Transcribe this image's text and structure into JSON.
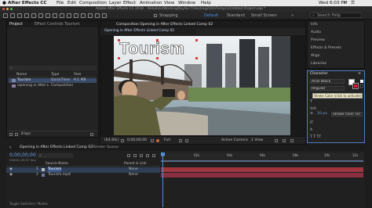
{
  "menubar": {
    "apple": "",
    "app_name": "After Effects CC",
    "items": [
      "File",
      "Edit",
      "Composition",
      "Layer",
      "Effect",
      "Animation",
      "View",
      "Window",
      "Help"
    ],
    "clock": "Wed 6:03 PM"
  },
  "titlebar": {
    "title": "Adobe After Effects CC 2018 - /Volumes/Working/Keyfer/7/Hosting2000/Temp/1/Untitled Project.aep *"
  },
  "toolbar": {
    "snapping": "Snapping",
    "workspaces": [
      "Default",
      "Standard",
      "Small Screen"
    ],
    "active_workspace": "Default",
    "search": "Search Help"
  },
  "project": {
    "tabs": [
      "Project",
      "Effect Controls Tourism"
    ],
    "columns": [
      "Name",
      "Type",
      "Size"
    ],
    "items": [
      {
        "name": "Tourism",
        "type": "QuickTime",
        "size": "9.1 MB"
      },
      {
        "name": "Opening in After Effects",
        "type": "Composition",
        "size": ""
      }
    ],
    "footer": "8 bpc"
  },
  "viewer": {
    "tab": "Composition Opening in After Effects Linked Comp 02",
    "subtab": "Opening in After Effects Linked Comp 02",
    "zoom": "(64.8%)",
    "timecode": "0;00;00;00",
    "resolution": "Full",
    "camera": "Active Camera",
    "views": "1 View",
    "overlay_text": "Tourism"
  },
  "right_panels": {
    "items": [
      "Info",
      "Audio",
      "Preview",
      "Effects & Presets",
      "Align",
      "Libraries"
    ]
  },
  "character": {
    "title": "Character",
    "font": "Arial Black",
    "style": "Regular",
    "tooltip": "Stroke Color (click to activate)",
    "stroke_width": "10 px",
    "stroke_mode": "Stroke Over Fill",
    "fill_color": "#ffffff",
    "stroke_color": "#cc2233"
  },
  "timeline": {
    "tabs": [
      "Opening in After Effects Linked Comp 02",
      "Render Queue"
    ],
    "timecode": "0;00;00;00",
    "fps": "00000 (29.97 fps)",
    "columns": [
      "Source Name",
      "Parent & Link"
    ],
    "layers": [
      {
        "index": "1",
        "name": "Tourism",
        "parent": "None"
      },
      {
        "index": "2",
        "name": "Tourism.mp4",
        "parent": "None"
      }
    ],
    "ruler": [
      "0s",
      "02s",
      "04s",
      "06s",
      "08s",
      "10s",
      "12s"
    ],
    "bottom": "Toggle Switches / Modes"
  }
}
